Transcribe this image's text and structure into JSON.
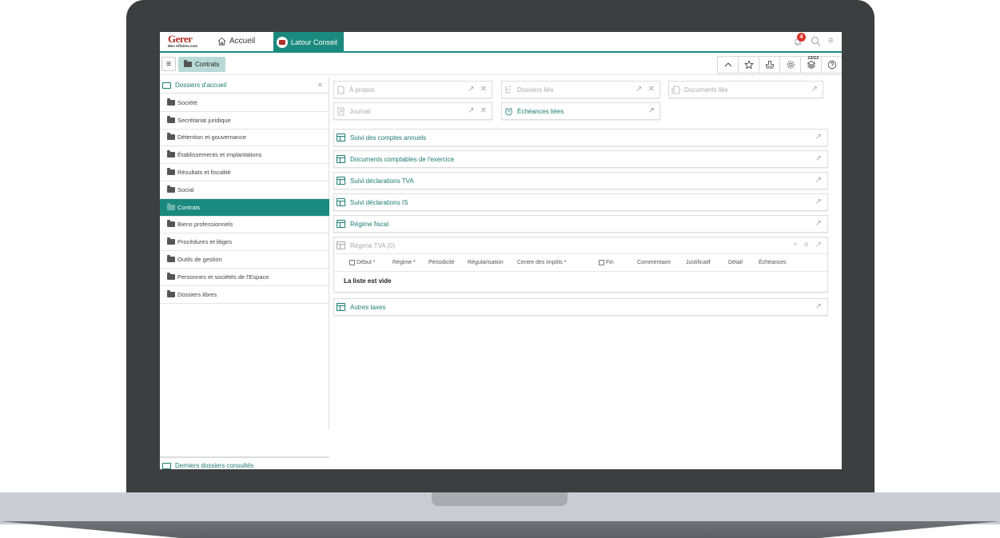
{
  "topnav": {
    "logo_main": "Gerer",
    "logo_sub": "Mes Affaires.com",
    "home_label": "Accueil",
    "active_tab": "Latour Conseil",
    "notification_count": "4",
    "brand_color": "#1b8a7e"
  },
  "toolbar": {
    "menu_glyph": "≡",
    "breadcrumb": "Contrats",
    "counter": "13/13",
    "icons": [
      "chevron-up-icon",
      "star-add-icon",
      "stamp-icon",
      "gear-icon",
      "layers-icon",
      "help-icon"
    ]
  },
  "sidebar": {
    "header": "Dossiers d'accueil",
    "header_menu": "≡",
    "items": [
      {
        "label": "Société"
      },
      {
        "label": "Secrétariat juridique"
      },
      {
        "label": "Détention et gouvernance"
      },
      {
        "label": "Établissements et implantations"
      },
      {
        "label": "Résultats et fiscalité"
      },
      {
        "label": "Social"
      },
      {
        "label": "Contrats",
        "active": true
      },
      {
        "label": "Biens professionnels"
      },
      {
        "label": "Procédures et litiges"
      },
      {
        "label": "Outils de gestion"
      },
      {
        "label": "Personnes et sociétés de l'Espace"
      },
      {
        "label": "Dossiers libres"
      }
    ],
    "footer": "Derniers dossiers consultés"
  },
  "cards": {
    "apropos": "À propos",
    "dossiers_lies": "Dossiers liés",
    "documents_lies": "Documents liés",
    "journal": "Journal",
    "echeances_liees": "Échéances liées"
  },
  "sections": [
    {
      "label": "Suivi des comptes annuels"
    },
    {
      "label": "Documents comptables de l'exercice"
    },
    {
      "label": "Suivi déclarations TVA"
    },
    {
      "label": "Suivi déclarations IS"
    },
    {
      "label": "Régime fiscal"
    }
  ],
  "tva": {
    "title": "Régime TVA (0)",
    "columns": [
      "Début *",
      "Régime *",
      "Périodicité",
      "Régularisation",
      "Centre des impôts *",
      "Fin",
      "Commentaire",
      "Justificatif",
      "Détail",
      "Échéances"
    ],
    "empty": "La liste est vide"
  },
  "autres": {
    "label": "Autres taxes"
  }
}
